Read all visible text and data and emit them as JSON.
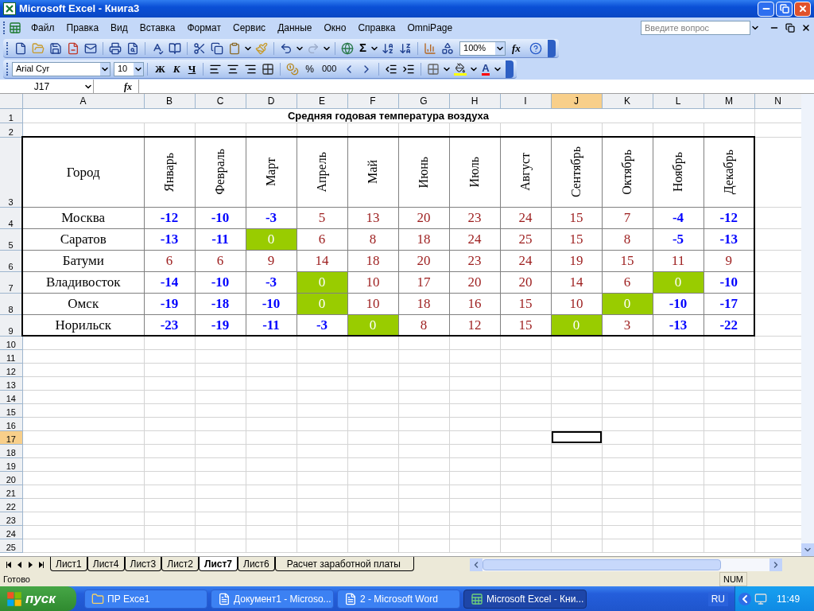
{
  "window": {
    "title": "Microsoft Excel - Книга3"
  },
  "menu": [
    "Файл",
    "Правка",
    "Вид",
    "Вставка",
    "Формат",
    "Сервис",
    "Данные",
    "Окно",
    "Справка",
    "OmniPage"
  ],
  "help_search": {
    "placeholder": "Введите вопрос"
  },
  "standard_toolbar": {
    "autosum": "Σ",
    "zoom": "100%",
    "function": "fx"
  },
  "formatting_toolbar": {
    "font": "Arial Cyr",
    "size": "10",
    "bold": "Ж",
    "italic": "К",
    "underline": "Ч",
    "percent": "%",
    "thousands": "000",
    "font_color": "A"
  },
  "formula_bar": {
    "name_box": "J17",
    "function": "fx"
  },
  "sheet": {
    "columns": [
      {
        "label": "A",
        "selected": false
      },
      {
        "label": "B",
        "selected": false
      },
      {
        "label": "C",
        "selected": false
      },
      {
        "label": "D",
        "selected": false
      },
      {
        "label": "E",
        "selected": false
      },
      {
        "label": "F",
        "selected": false
      },
      {
        "label": "G",
        "selected": false
      },
      {
        "label": "H",
        "selected": false
      },
      {
        "label": "I",
        "selected": false
      },
      {
        "label": "J",
        "selected": true
      },
      {
        "label": "K",
        "selected": false
      },
      {
        "label": "L",
        "selected": false
      },
      {
        "label": "M",
        "selected": false
      },
      {
        "label": "N",
        "selected": false
      }
    ],
    "rows": [
      {
        "label": "1",
        "selected": false
      },
      {
        "label": "2",
        "selected": false
      },
      {
        "label": "3",
        "selected": false
      },
      {
        "label": "4",
        "selected": false
      },
      {
        "label": "5",
        "selected": false
      },
      {
        "label": "6",
        "selected": false
      },
      {
        "label": "7",
        "selected": false
      },
      {
        "label": "8",
        "selected": false
      },
      {
        "label": "9",
        "selected": false
      },
      {
        "label": "10",
        "selected": false
      },
      {
        "label": "11",
        "selected": false
      },
      {
        "label": "12",
        "selected": false
      },
      {
        "label": "13",
        "selected": false
      },
      {
        "label": "14",
        "selected": false
      },
      {
        "label": "15",
        "selected": false
      },
      {
        "label": "16",
        "selected": false
      },
      {
        "label": "17",
        "selected": true
      },
      {
        "label": "18",
        "selected": false
      },
      {
        "label": "19",
        "selected": false
      },
      {
        "label": "20",
        "selected": false
      },
      {
        "label": "21",
        "selected": false
      },
      {
        "label": "22",
        "selected": false
      },
      {
        "label": "23",
        "selected": false
      },
      {
        "label": "24",
        "selected": false
      },
      {
        "label": "25",
        "selected": false
      }
    ],
    "title": "Средняя годовая температура воздуха",
    "city_header": "Город",
    "months": [
      "Январь",
      "Февраль",
      "Март",
      "Апрель",
      "Май",
      "Июнь",
      "Июль",
      "Август",
      "Сентябрь",
      "Октябрь",
      "Ноябрь",
      "Декабрь"
    ],
    "data": [
      {
        "city": "Москва",
        "cells": [
          {
            "value": "-12",
            "kind": "cold"
          },
          {
            "value": "-10",
            "kind": "cold"
          },
          {
            "value": "-3",
            "kind": "cold"
          },
          {
            "value": "5",
            "kind": "warm"
          },
          {
            "value": "13",
            "kind": "warm"
          },
          {
            "value": "20",
            "kind": "warm"
          },
          {
            "value": "23",
            "kind": "warm"
          },
          {
            "value": "24",
            "kind": "warm"
          },
          {
            "value": "15",
            "kind": "warm"
          },
          {
            "value": "7",
            "kind": "warm"
          },
          {
            "value": "-4",
            "kind": "cold"
          },
          {
            "value": "-12",
            "kind": "cold"
          }
        ]
      },
      {
        "city": "Саратов",
        "cells": [
          {
            "value": "-13",
            "kind": "cold"
          },
          {
            "value": "-11",
            "kind": "cold"
          },
          {
            "value": "0",
            "kind": "zero"
          },
          {
            "value": "6",
            "kind": "warm"
          },
          {
            "value": "8",
            "kind": "warm"
          },
          {
            "value": "18",
            "kind": "warm"
          },
          {
            "value": "24",
            "kind": "warm"
          },
          {
            "value": "25",
            "kind": "warm"
          },
          {
            "value": "15",
            "kind": "warm"
          },
          {
            "value": "8",
            "kind": "warm"
          },
          {
            "value": "-5",
            "kind": "cold"
          },
          {
            "value": "-13",
            "kind": "cold"
          }
        ]
      },
      {
        "city": "Батуми",
        "cells": [
          {
            "value": "6",
            "kind": "warm"
          },
          {
            "value": "6",
            "kind": "warm"
          },
          {
            "value": "9",
            "kind": "warm"
          },
          {
            "value": "14",
            "kind": "warm"
          },
          {
            "value": "18",
            "kind": "warm"
          },
          {
            "value": "20",
            "kind": "warm"
          },
          {
            "value": "23",
            "kind": "warm"
          },
          {
            "value": "24",
            "kind": "warm"
          },
          {
            "value": "19",
            "kind": "warm"
          },
          {
            "value": "15",
            "kind": "warm"
          },
          {
            "value": "11",
            "kind": "warm"
          },
          {
            "value": "9",
            "kind": "warm"
          }
        ]
      },
      {
        "city": "Владивосток",
        "cells": [
          {
            "value": "-14",
            "kind": "cold"
          },
          {
            "value": "-10",
            "kind": "cold"
          },
          {
            "value": "-3",
            "kind": "cold"
          },
          {
            "value": "0",
            "kind": "zero"
          },
          {
            "value": "10",
            "kind": "warm"
          },
          {
            "value": "17",
            "kind": "warm"
          },
          {
            "value": "20",
            "kind": "warm"
          },
          {
            "value": "20",
            "kind": "warm"
          },
          {
            "value": "14",
            "kind": "warm"
          },
          {
            "value": "6",
            "kind": "warm"
          },
          {
            "value": "0",
            "kind": "zero"
          },
          {
            "value": "-10",
            "kind": "cold"
          }
        ]
      },
      {
        "city": "Омск",
        "cells": [
          {
            "value": "-19",
            "kind": "cold"
          },
          {
            "value": "-18",
            "kind": "cold"
          },
          {
            "value": "-10",
            "kind": "cold"
          },
          {
            "value": "0",
            "kind": "zero"
          },
          {
            "value": "10",
            "kind": "warm"
          },
          {
            "value": "18",
            "kind": "warm"
          },
          {
            "value": "16",
            "kind": "warm"
          },
          {
            "value": "15",
            "kind": "warm"
          },
          {
            "value": "10",
            "kind": "warm"
          },
          {
            "value": "0",
            "kind": "zero"
          },
          {
            "value": "-10",
            "kind": "cold"
          },
          {
            "value": "-17",
            "kind": "cold"
          }
        ]
      },
      {
        "city": "Норильск",
        "cells": [
          {
            "value": "-23",
            "kind": "cold"
          },
          {
            "value": "-19",
            "kind": "cold"
          },
          {
            "value": "-11",
            "kind": "cold"
          },
          {
            "value": "-3",
            "kind": "cold"
          },
          {
            "value": "0",
            "kind": "zero"
          },
          {
            "value": "8",
            "kind": "warm"
          },
          {
            "value": "12",
            "kind": "warm"
          },
          {
            "value": "15",
            "kind": "warm"
          },
          {
            "value": "0",
            "kind": "zero"
          },
          {
            "value": "3",
            "kind": "warm"
          },
          {
            "value": "-13",
            "kind": "cold"
          },
          {
            "value": "-22",
            "kind": "cold"
          }
        ]
      }
    ]
  },
  "sheet_tabs": [
    {
      "label": "Лист1",
      "selected": false
    },
    {
      "label": "Лист4",
      "selected": false
    },
    {
      "label": "Лист3",
      "selected": false
    },
    {
      "label": "Лист2",
      "selected": false
    },
    {
      "label": "Лист7",
      "selected": true
    },
    {
      "label": "Лист6",
      "selected": false
    },
    {
      "label": "Расчет заработной платы",
      "selected": false
    }
  ],
  "status_bar": {
    "text": "Готово",
    "indicator": "NUM"
  },
  "taskbar": {
    "start": "пуск",
    "tasks": [
      {
        "label": "ПР Exce1",
        "kind": "folder",
        "selected": false
      },
      {
        "label": "Документ1 - Microso...",
        "kind": "word",
        "selected": false
      },
      {
        "label": "2 - Microsoft Word",
        "kind": "word",
        "selected": false
      },
      {
        "label": "Microsoft Excel - Кни...",
        "kind": "excel",
        "selected": true
      }
    ],
    "language": "RU",
    "clock": "11:49"
  }
}
